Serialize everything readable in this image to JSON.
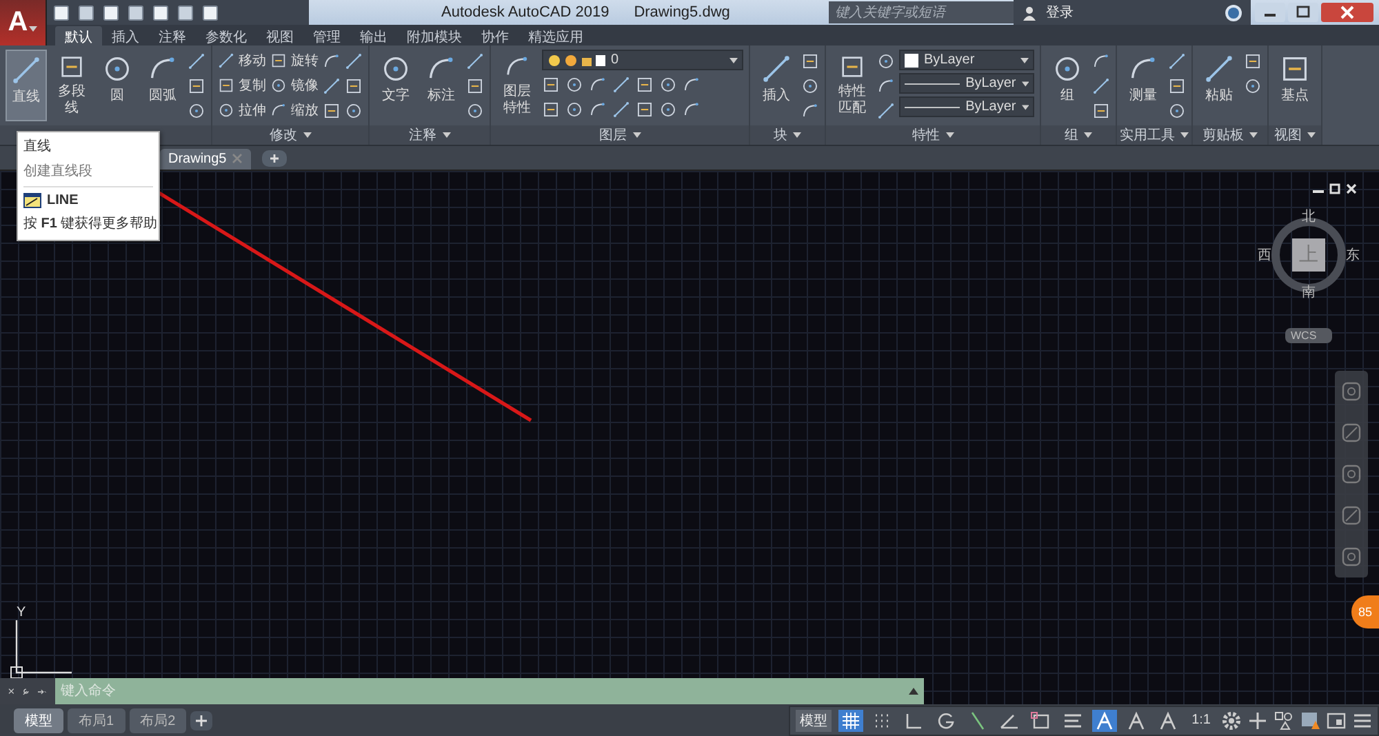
{
  "app_menu": {
    "label": "A"
  },
  "title_bar": {
    "title": "Autodesk AutoCAD 2019",
    "document": "Drawing5.dwg",
    "search": {
      "placeholder": "键入关键字或短语"
    },
    "login": "登录"
  },
  "ribbon_tabs": [
    {
      "label": "默认",
      "selected": true
    },
    {
      "label": "插入",
      "selected": false
    },
    {
      "label": "注释",
      "selected": false
    },
    {
      "label": "参数化",
      "selected": false
    },
    {
      "label": "视图",
      "selected": false
    },
    {
      "label": "管理",
      "selected": false
    },
    {
      "label": "输出",
      "selected": false
    },
    {
      "label": "附加模块",
      "selected": false
    },
    {
      "label": "协作",
      "selected": false
    },
    {
      "label": "精选应用",
      "selected": false
    }
  ],
  "ribbon_panels": [
    {
      "columns": [
        [
          {
            "kind": "large",
            "label": "直线",
            "selected": true
          }
        ],
        [
          {
            "kind": "large",
            "label": "多段线",
            "selected": false
          }
        ],
        [
          {
            "kind": "large",
            "label": "圆",
            "selected": false
          }
        ],
        [
          {
            "kind": "large",
            "label": "圆弧",
            "selected": false
          }
        ],
        [
          {
            "kind": "icon"
          },
          {
            "kind": "icon"
          },
          {
            "kind": "icon"
          }
        ]
      ]
    },
    {
      "title": "修改",
      "columns": [
        [
          {
            "kind": "small",
            "label": "移动"
          },
          {
            "kind": "small",
            "label": "复制"
          },
          {
            "kind": "small",
            "label": "拉伸"
          }
        ],
        [
          {
            "kind": "small",
            "label": "旋转"
          },
          {
            "kind": "small",
            "label": "镜像"
          },
          {
            "kind": "small",
            "label": "缩放"
          }
        ],
        [
          {
            "kind": "icon"
          },
          {
            "kind": "icon"
          },
          {
            "kind": "icon"
          }
        ],
        [
          {
            "kind": "icon"
          },
          {
            "kind": "icon"
          },
          {
            "kind": "icon"
          }
        ]
      ]
    },
    {
      "title": "注释",
      "columns": [
        [
          {
            "kind": "large",
            "label": "文字",
            "selected": false
          }
        ],
        [
          {
            "kind": "large",
            "label": "标注",
            "selected": false
          }
        ],
        [
          {
            "kind": "icon"
          },
          {
            "kind": "icon"
          },
          {
            "kind": "icon"
          }
        ]
      ]
    },
    {
      "title": "图层",
      "columns": [
        [
          {
            "kind": "large",
            "label": "图层特性",
            "selected": false
          }
        ],
        [
          {
            "kind": "layer-dropdown",
            "value": "0"
          },
          {
            "kind": "icon-row"
          },
          {
            "kind": "icon-row"
          }
        ]
      ]
    },
    {
      "title": "块",
      "columns": [
        [
          {
            "kind": "large",
            "label": "插入",
            "selected": false
          }
        ],
        [
          {
            "kind": "icon"
          },
          {
            "kind": "icon"
          },
          {
            "kind": "icon"
          }
        ]
      ]
    },
    {
      "title": "特性",
      "columns": [
        [
          {
            "kind": "large",
            "label": "特性匹配",
            "selected": false
          }
        ],
        [
          {
            "kind": "icon"
          },
          {
            "kind": "icon"
          },
          {
            "kind": "icon"
          }
        ],
        [
          {
            "kind": "color-dropdown",
            "value": "ByLayer"
          },
          {
            "kind": "line-dropdown",
            "value": "ByLayer"
          },
          {
            "kind": "line-dropdown",
            "value": "ByLayer"
          }
        ]
      ]
    },
    {
      "title": "组",
      "columns": [
        [
          {
            "kind": "large",
            "label": "组",
            "selected": false
          }
        ],
        [
          {
            "kind": "icon"
          },
          {
            "kind": "icon"
          },
          {
            "kind": "icon"
          }
        ]
      ]
    },
    {
      "title": "实用工具",
      "columns": [
        [
          {
            "kind": "large",
            "label": "测量",
            "selected": false
          }
        ],
        [
          {
            "kind": "icon"
          },
          {
            "kind": "icon"
          },
          {
            "kind": "icon"
          }
        ]
      ]
    },
    {
      "title": "剪贴板",
      "columns": [
        [
          {
            "kind": "large",
            "label": "粘贴",
            "selected": false
          }
        ],
        [
          {
            "kind": "icon"
          },
          {
            "kind": "icon"
          }
        ]
      ]
    },
    {
      "title": "视图",
      "columns": [
        [
          {
            "kind": "large",
            "label": "基点",
            "selected": false
          }
        ]
      ]
    }
  ],
  "tooltip": {
    "title": "直线",
    "description": "创建直线段",
    "command": "LINE",
    "help": "按 **F1** 键获得更多帮助"
  },
  "file_tabs": [
    {
      "label": "Drawing5",
      "selected": true
    }
  ],
  "viewcube": {
    "north": "北",
    "south": "南",
    "east": "东",
    "west": "西",
    "face": "上",
    "ucs": "WCS"
  },
  "ucs_icon": {
    "axis": "Y"
  },
  "badge": {
    "label": "85"
  },
  "command_line": {
    "placeholder": "键入命令"
  },
  "layout_tabs": [
    {
      "label": "模型",
      "selected": true
    },
    {
      "label": "布局1",
      "selected": false
    },
    {
      "label": "布局2",
      "selected": false
    }
  ],
  "status_bar": {
    "space": "模型",
    "tools": [
      {
        "kind": "grid",
        "on": true
      },
      {
        "kind": "snap",
        "on": false
      },
      {
        "kind": "ortho",
        "on": false
      },
      {
        "kind": "polar",
        "on": false
      },
      {
        "kind": "iso",
        "on": false
      },
      {
        "kind": "track",
        "on": false
      },
      {
        "kind": "osnap",
        "on": false
      },
      {
        "kind": "lineweight",
        "on": false
      },
      {
        "kind": "annotate",
        "on": true
      },
      {
        "kind": "autoscale",
        "on": false
      },
      {
        "kind": "annoscale",
        "on": false
      }
    ],
    "scale": "1:1"
  }
}
